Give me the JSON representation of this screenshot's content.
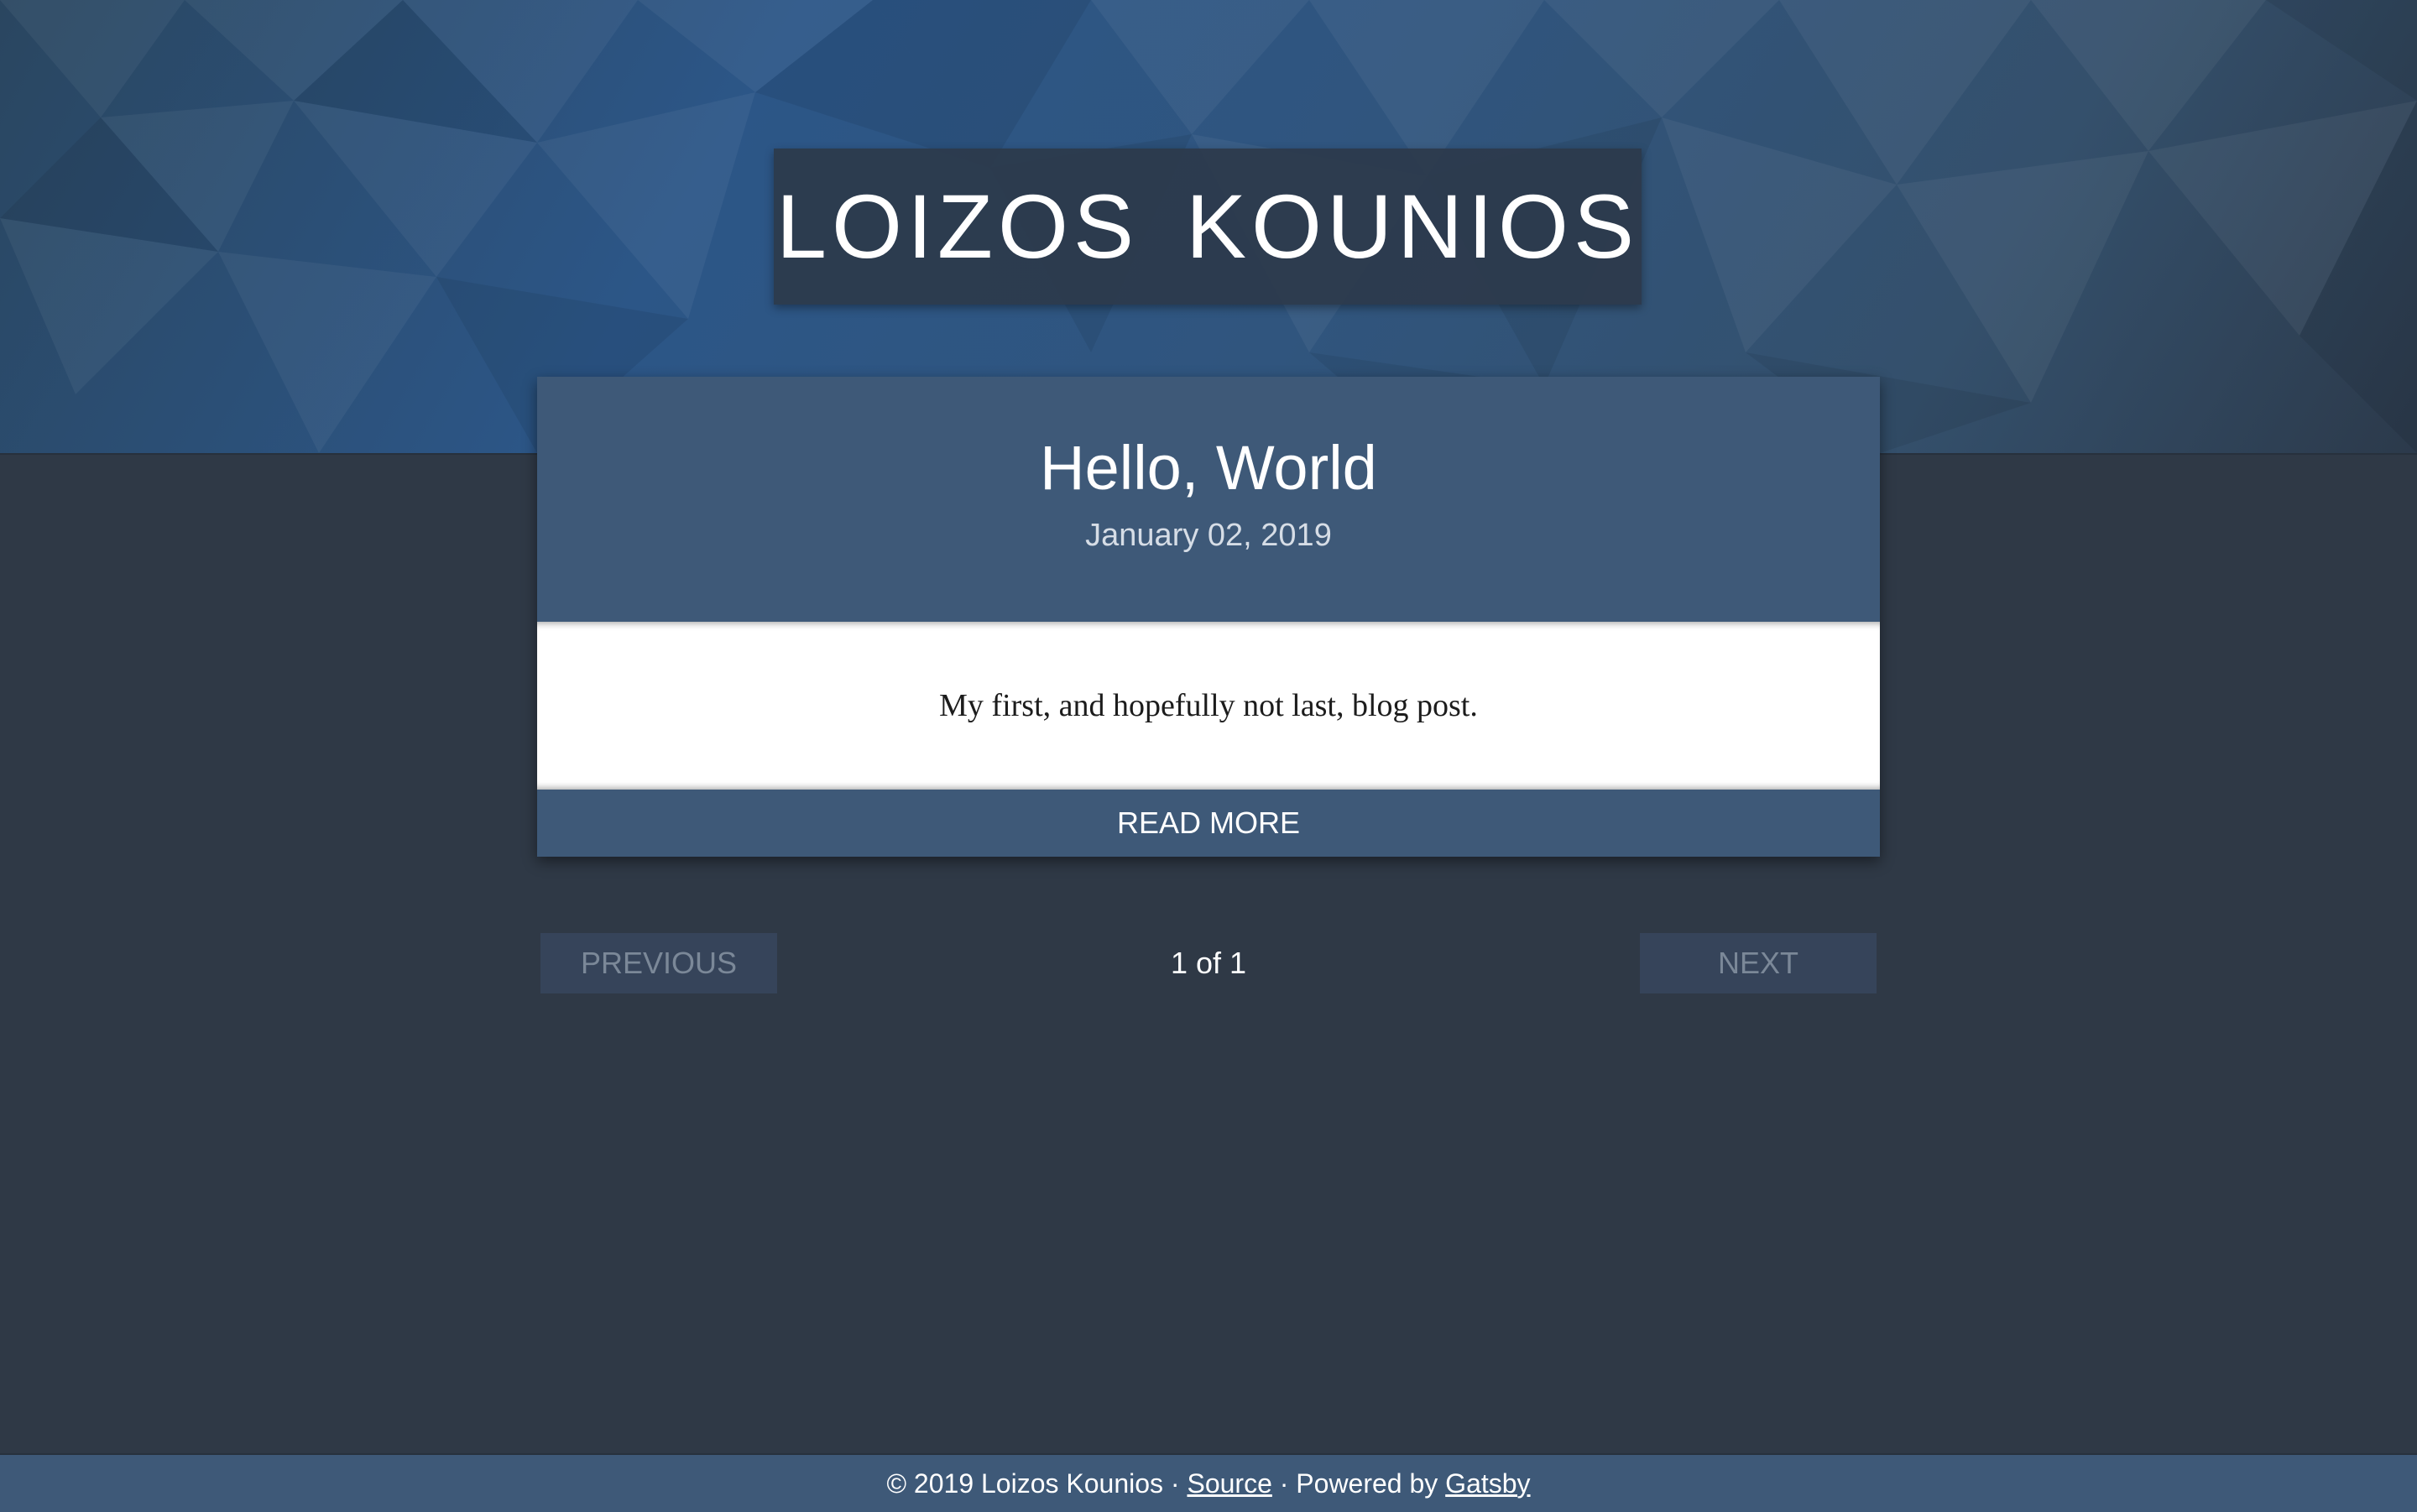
{
  "site": {
    "title": "LOIZOS KOUNIOS"
  },
  "post": {
    "title": "Hello, World",
    "date": "January 02, 2019",
    "excerpt": "My first, and hopefully not last, blog post.",
    "read_more_label": "READ MORE"
  },
  "pagination": {
    "previous_label": "PREVIOUS",
    "next_label": "NEXT",
    "page_indicator": "1 of 1"
  },
  "footer": {
    "copyright": "© 2019 Loizos Kounios",
    "separator": " · ",
    "source_label": "Source",
    "powered_by": "Powered by ",
    "gatsby_label": "Gatsby"
  },
  "colors": {
    "background": "#2f3946",
    "accent": "#3e5978",
    "title_box": "#2c3a4b",
    "pager_button": "#36445a"
  }
}
